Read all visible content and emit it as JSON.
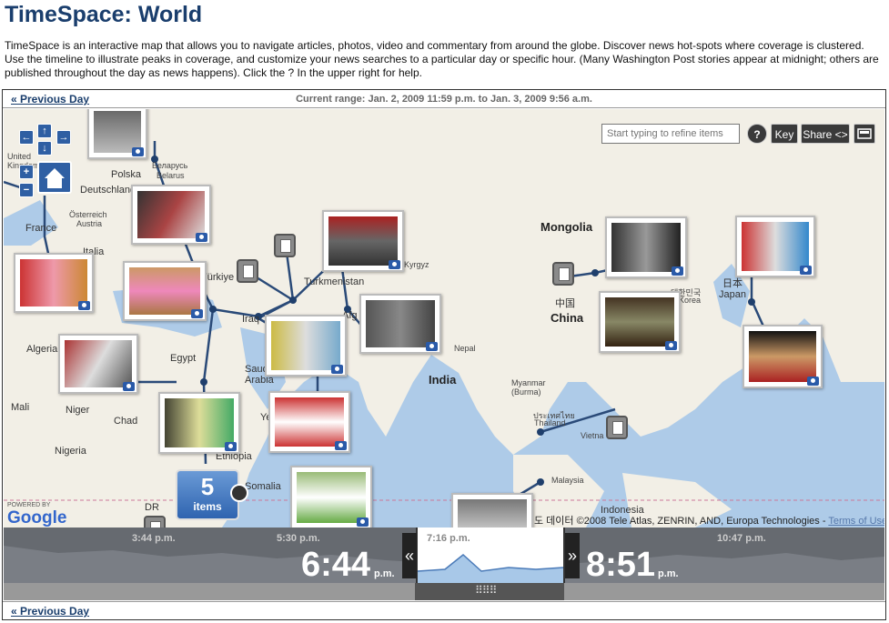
{
  "page": {
    "title": "TimeSpace: World",
    "intro": "TimeSpace is an interactive map that allows you to navigate articles, photos, video and commentary from around the globe. Discover news hot-spots where coverage is clustered. Use the timeline to illustrate peaks in coverage, and customize your news searches to a particular day or specific hour. (Many Washington Post stories appear at midnight; others are published throughout the day as news happens). Click the ? In the upper right for help."
  },
  "topbar": {
    "prev_label": "« Previous Day",
    "range": "Current range: Jan. 2, 2009 11:59 p.m. to Jan. 3, 2009 9:56 a.m."
  },
  "toolbar": {
    "search_placeholder": "Start typing to refine items",
    "help_label": "?",
    "key_label": "Key",
    "share_label": "Share <>"
  },
  "map": {
    "labels": {
      "polska": "Polska",
      "belarus": "Беларусь",
      "belarus_en": "Belarus",
      "united_kingdom": "United\nKingdom",
      "deutschland": "Deutschland",
      "osterreich": "Österreich",
      "austria": "Austria",
      "france": "France",
      "italia": "Italia",
      "turkiye": "Türkiye",
      "algeria": "Algeria",
      "egypt": "Egypt",
      "iraq": "Iraq",
      "saudi_arabia": "Saudi\nArabia",
      "mali": "Mali",
      "niger": "Niger",
      "chad": "Chad",
      "nigeria": "Nigeria",
      "ethiopia": "Ethiopia",
      "somalia": "Somalia",
      "turkmenistan": "Turkmenistan",
      "kyrgyz": "Kyrgyz",
      "afg": "Afg",
      "india": "India",
      "nepal": "Nepal",
      "mongolia": "Mongolia",
      "china_cn": "中国",
      "china": "China",
      "korea_kr": "대한민국",
      "korea": "Korea",
      "japan_jp": "日本",
      "japan": "Japan",
      "myanmar": "Myanmar\n(Burma)",
      "thailand_th": "ประเทศไทย",
      "thailand": "Thailand",
      "vietnam": "Vietna",
      "malaysia": "Malaysia",
      "indonesia": "Indonesia",
      "dr": "DR",
      "ye": "Ye"
    },
    "cluster": {
      "count": "5",
      "label": "items"
    },
    "google_powered": "POWERED BY",
    "google": "Google",
    "copyright": "©2008 Tele Atlas, ZENRIN, AND, Europa Technologies -",
    "copyright_prefix": "도 데이터",
    "terms": "Terms of Use"
  },
  "timeline": {
    "ticks": [
      "3:44 p.m.",
      "5:30 p.m.",
      "7:16 p.m.",
      "10:47 p.m."
    ],
    "start_time": "6:44",
    "start_ampm": "p.m.",
    "end_time": "8:51",
    "end_ampm": "p.m.",
    "left_arrow": "«",
    "right_arrow": "»"
  },
  "bottombar": {
    "prev_label": "« Previous Day"
  },
  "colors": {
    "title": "#1a3e6d",
    "accent": "#2f5fa3",
    "map_water": "#aecbe8",
    "map_land": "#f2efe6"
  }
}
